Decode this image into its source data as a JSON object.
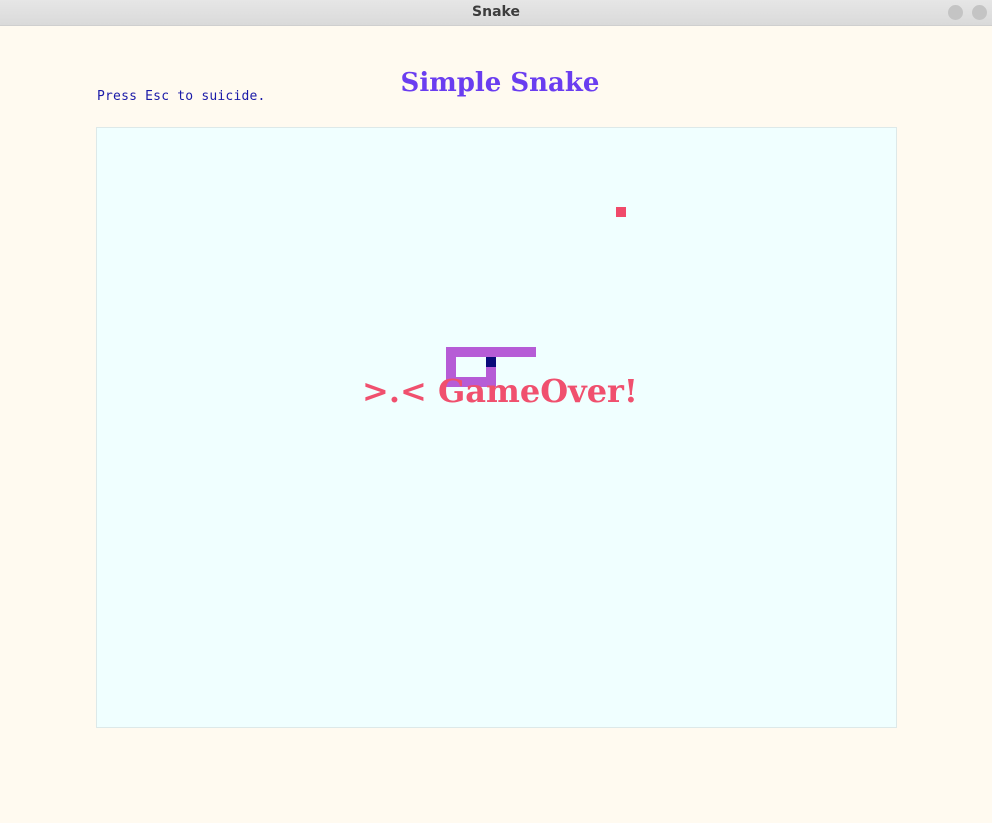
{
  "window": {
    "title": "Snake"
  },
  "hud": {
    "hint": "Press Esc to suicide.",
    "title": "Simple Snake"
  },
  "game": {
    "status_message": ">.< GameOver!",
    "colors": {
      "background": "#fffaf0",
      "board": "#f0ffff",
      "food": "#f04a6a",
      "snake_body": "#b65cd6",
      "snake_head": "#0a0a7a",
      "title": "#6a3df0",
      "hint": "#1a1aa8",
      "gameover": "#f0506e"
    }
  }
}
